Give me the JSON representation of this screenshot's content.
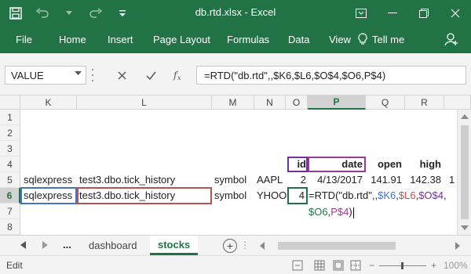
{
  "window": {
    "title": "db.rtd.xlsx  -  Excel",
    "accent": "#217346"
  },
  "ribbon": {
    "tabs": [
      "File",
      "Home",
      "Insert",
      "Page Layout",
      "Formulas",
      "Data",
      "View"
    ],
    "tell_me": "Tell me"
  },
  "formula_bar": {
    "name_box": "VALUE",
    "formula": "=RTD(\"db.rtd\",,$K6,$L6,$O$4,$O6,P$4)",
    "icons": [
      "cancel-icon",
      "enter-icon",
      "insert-function-icon"
    ]
  },
  "grid": {
    "columns": [
      "K",
      "L",
      "M",
      "N",
      "O",
      "P",
      "Q",
      "R"
    ],
    "selected_column": "P",
    "rows": [
      "1",
      "2",
      "3",
      "4",
      "5",
      "6",
      "7",
      "8"
    ],
    "selected_row": "6",
    "header_row": {
      "O": "id",
      "P": "date",
      "Q": "open",
      "R": "high"
    },
    "row5": {
      "K": "sqlexpress",
      "L": "test3.dbo.tick_history",
      "M": "symbol",
      "N": "AAPL",
      "O": "2",
      "P": "4/13/2017",
      "Q": "141.91",
      "R": "142.38",
      "S": "1"
    },
    "row6": {
      "K": "sqlexpress",
      "L": "test3.dbo.tick_history",
      "M": "symbol",
      "N": "YHOO",
      "O": "4"
    },
    "editing": {
      "line1": {
        "prefix": "=RTD(\"db.rtd\",,",
        "ref_k": "$K6",
        "comma1": ",",
        "ref_l": "$L6",
        "comma2": ",",
        "ref_o4": "$O$4",
        "comma3": ","
      },
      "line2": {
        "ref_o6": "$O6",
        "comma": ",",
        "ref_p4": "P$4",
        "suffix": ")"
      },
      "ref_colors": {
        "K": "#4472c4",
        "L": "#c0504d",
        "O4": "#7030a0",
        "O6": "#217346",
        "P4": "#9b3b8f"
      }
    }
  },
  "sheets": {
    "more": "...",
    "tabs": [
      "dashboard",
      "stocks"
    ],
    "active": "stocks"
  },
  "status": {
    "mode": "Edit",
    "zoom": "100%",
    "zoom_fraction": 0.5
  }
}
